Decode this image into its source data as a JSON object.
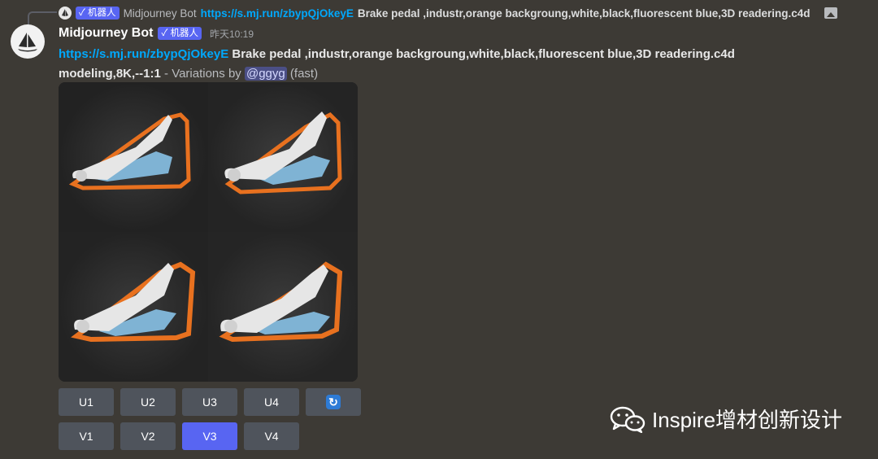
{
  "reply": {
    "bot_name": "Midjourney Bot",
    "badge": "✓ 机器人",
    "link": "https://s.mj.run/zbypQjOkeyE",
    "text": "Brake pedal ,industr,orange backgroung,white,black,fluorescent blue,3D readering.c4d"
  },
  "message": {
    "username": "Midjourney Bot",
    "badge": "✓ 机器人",
    "timestamp": "昨天10:19",
    "link": "https://s.mj.run/zbypQjOkeyE",
    "prompt_line1": "Brake pedal ,industr,orange backgroung,white,black,fluorescent blue,3D readering.c4d",
    "prompt_line2": "modeling,8K,--1:1",
    "suffix": " - Variations by ",
    "mention": "@ggyg",
    "speed": "(fast)"
  },
  "buttons": {
    "upscale": [
      "U1",
      "U2",
      "U3",
      "U4"
    ],
    "variation": [
      "V1",
      "V2",
      "V3",
      "V4"
    ],
    "refresh_icon": "refresh-icon",
    "active": "V3"
  },
  "watermark": {
    "text": "Inspire增材创新设计",
    "icon": "wechat-icon"
  },
  "colors": {
    "background": "#3d3a35",
    "badge": "#5865f2",
    "link": "#00a8fc",
    "button": "#4f545c",
    "button_active": "#5865f2",
    "orange": "#e8711f",
    "blue": "#7fb3d4"
  }
}
